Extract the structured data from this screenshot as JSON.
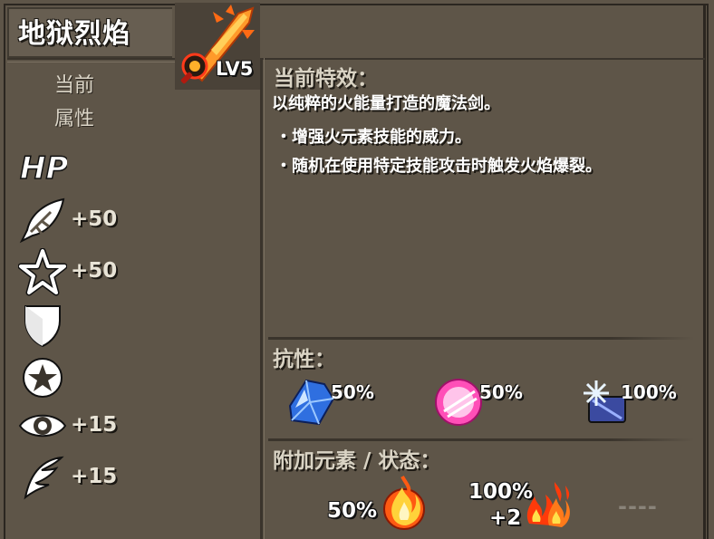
{
  "item": {
    "name": "地狱烈焰",
    "level": "LV5"
  },
  "current_attr": {
    "line1": "当前",
    "line2": "属性"
  },
  "stats": [
    {
      "icon": "hp-icon",
      "label": "HP",
      "value": ""
    },
    {
      "icon": "attack-leaf-icon",
      "value": "+50"
    },
    {
      "icon": "star-outline-icon",
      "value": "+50"
    },
    {
      "icon": "shield-icon",
      "value": ""
    },
    {
      "icon": "star-badge-icon",
      "value": ""
    },
    {
      "icon": "eye-icon",
      "value": "+15"
    },
    {
      "icon": "wing-icon",
      "value": "+15"
    }
  ],
  "effect": {
    "heading": "当前特效：",
    "description": "以纯粹的火能量打造的魔法剑。",
    "bullets": [
      "・增强火元素技能的威力。",
      "・随机在使用特定技能攻击时触发火焰爆裂。"
    ]
  },
  "resistance": {
    "heading": "抗性：",
    "items": [
      {
        "icon": "ice-crystal-icon",
        "value": "50%"
      },
      {
        "icon": "pink-orb-icon",
        "value": "50%"
      },
      {
        "icon": "snowflake-icon",
        "value": "100%"
      }
    ]
  },
  "additional": {
    "heading": "附加元素 / 状态：",
    "items": [
      {
        "icon": "fire-orb-icon",
        "value": "50%"
      },
      {
        "icon": "flames-icon",
        "value": "100%",
        "extra": "+2"
      },
      {
        "icon": "empty-slot",
        "value": "----"
      }
    ]
  },
  "colors": {
    "background": "#5e5548",
    "fire": "#ff7a1a",
    "ice": "#2f6fe0",
    "pink": "#ff4fb8"
  }
}
